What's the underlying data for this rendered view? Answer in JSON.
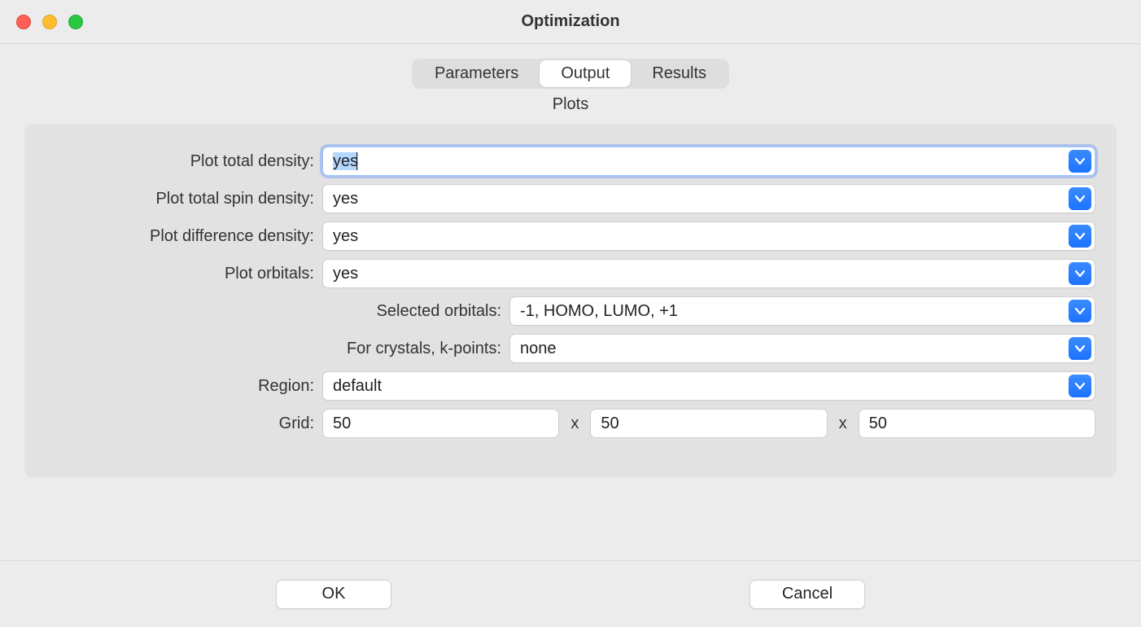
{
  "window": {
    "title": "Optimization"
  },
  "tabs": {
    "items": [
      {
        "label": "Parameters"
      },
      {
        "label": "Output"
      },
      {
        "label": "Results"
      }
    ],
    "activeIndex": 1
  },
  "section": {
    "title": "Plots"
  },
  "fields": {
    "plot_total_density": {
      "label": "Plot total density:",
      "value": "yes"
    },
    "plot_total_spin_density": {
      "label": "Plot total spin density:",
      "value": "yes"
    },
    "plot_difference_density": {
      "label": "Plot difference density:",
      "value": "yes"
    },
    "plot_orbitals": {
      "label": "Plot orbitals:",
      "value": "yes"
    },
    "selected_orbitals": {
      "label": "Selected orbitals:",
      "value": "-1, HOMO, LUMO, +1"
    },
    "crystals_kpoints": {
      "label": "For crystals, k-points:",
      "value": "none"
    },
    "region": {
      "label": "Region:",
      "value": "default"
    },
    "grid": {
      "label": "Grid:",
      "separator": "x",
      "x": "50",
      "y": "50",
      "z": "50"
    }
  },
  "buttons": {
    "ok": "OK",
    "cancel": "Cancel"
  },
  "icons": {
    "chevron_down": "chevron-down"
  }
}
